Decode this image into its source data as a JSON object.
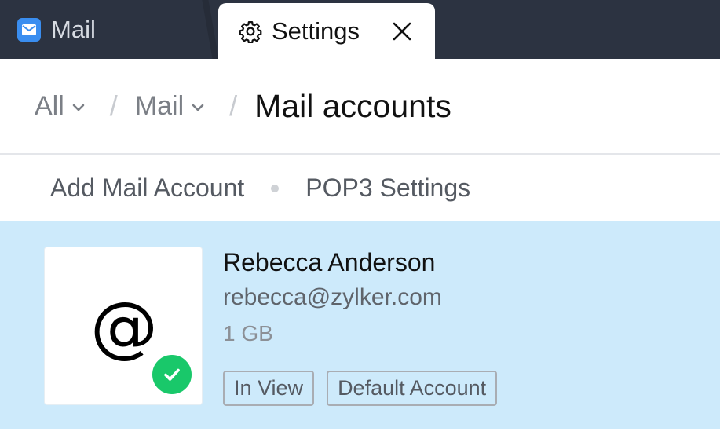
{
  "tabs": {
    "mail_label": "Mail",
    "settings_label": "Settings"
  },
  "breadcrumb": {
    "level1": "All",
    "level2": "Mail",
    "current": "Mail accounts",
    "separator": "/"
  },
  "subnav": {
    "add_account": "Add Mail Account",
    "pop3": "POP3 Settings"
  },
  "account": {
    "name": "Rebecca Anderson",
    "email": "rebecca@zylker.com",
    "storage": "1 GB",
    "avatar_symbol": "@",
    "badges": [
      "In View",
      "Default Account"
    ],
    "status": "verified"
  },
  "colors": {
    "tabbar_bg": "#2c3341",
    "selected_row_bg": "#cdeafb",
    "check_green": "#19c86a",
    "mail_icon_blue": "#3a8ef0"
  },
  "icons": {
    "mail_tab": "mail-icon",
    "settings_tab": "gear-icon",
    "close": "close-icon",
    "dropdown": "chevron-down-icon",
    "verified": "check-circle-icon"
  }
}
